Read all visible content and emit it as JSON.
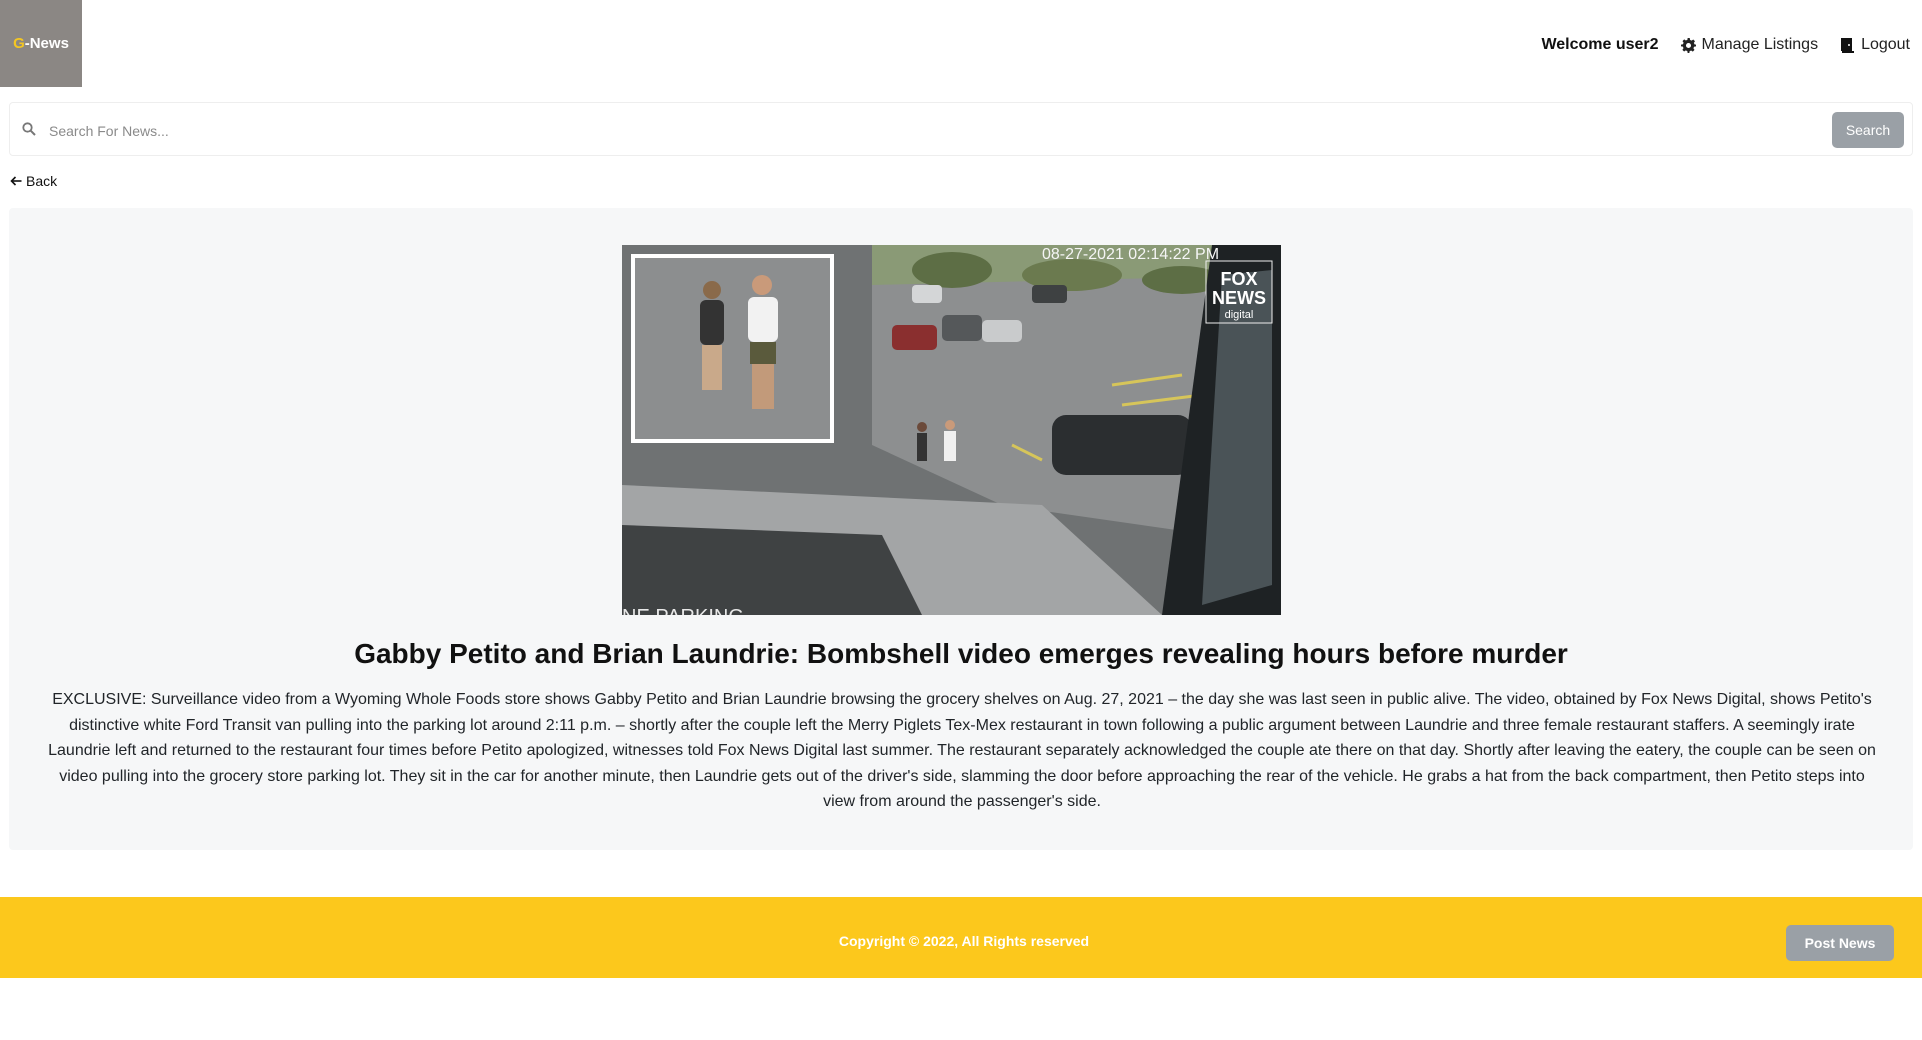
{
  "brand": {
    "logo_prefix": "G",
    "logo_rest": "-News",
    "accent_color": "#f3c623"
  },
  "nav": {
    "welcome": "Welcome user2",
    "manage_listings": "Manage Listings",
    "logout": "Logout"
  },
  "search": {
    "placeholder": "Search For News...",
    "value": "",
    "button": "Search"
  },
  "back_label": "Back",
  "article": {
    "image_overlay": {
      "timestamp": "08-27-2021 02:14:22 PM",
      "watermark_line1": "FOX",
      "watermark_line2": "NEWS",
      "watermark_line3": "digital",
      "bottom_text": "NE PARKING"
    },
    "title": "Gabby Petito and Brian Laundrie: Bombshell video emerges revealing hours before murder",
    "body": "EXCLUSIVE: Surveillance video from a Wyoming Whole Foods store shows Gabby Petito and Brian Laundrie browsing the grocery shelves on Aug. 27, 2021 – the day she was last seen in public alive. The video, obtained by Fox News Digital, shows Petito's distinctive white Ford Transit van pulling into the parking lot around 2:11 p.m. – shortly after the couple left the Merry Piglets Tex-Mex restaurant in town following a public argument between Laundrie and three female restaurant staffers. A seemingly irate Laundrie left and returned to the restaurant four times before Petito apologized, witnesses told Fox News Digital last summer. The restaurant separately acknowledged the couple ate there on that day. Shortly after leaving the eatery, the couple can be seen on video pulling into the grocery store parking lot. They sit in the car for another minute, then Laundrie gets out of the driver's side, slamming the door before approaching the rear of the vehicle. He grabs a hat from the back compartment, then Petito steps into view from around the passenger's side."
  },
  "footer": {
    "copyright": "Copyright © 2022, All Rights reserved",
    "post_button": "Post News",
    "background_color": "#fcc81c"
  },
  "icons": [
    "search-icon",
    "gear-icon",
    "logout-icon",
    "arrow-left-icon"
  ]
}
